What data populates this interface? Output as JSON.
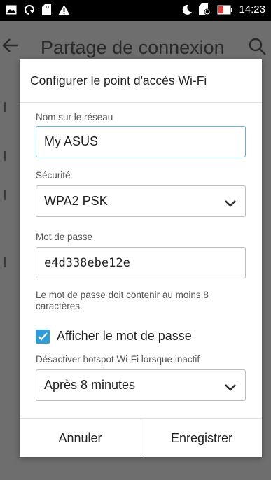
{
  "status_bar": {
    "time": "14:23",
    "icons_left": [
      "gallery-icon",
      "refresh-icon",
      "sd-card-icon",
      "warning-icon"
    ],
    "icons_right": [
      "moon-icon",
      "battery-saver-icon",
      "battery-icon"
    ],
    "battery_color": "#e53935"
  },
  "background_screen": {
    "title": "Partage de connexion"
  },
  "dialog": {
    "title": "Configurer le point d'accès Wi-Fi",
    "network_name": {
      "label": "Nom sur le réseau",
      "value": "My ASUS"
    },
    "security": {
      "label": "Sécurité",
      "selected": "WPA2 PSK"
    },
    "password": {
      "label": "Mot de passe",
      "value": "e4d338ebe12e",
      "hint": "Le mot de passe doit contenir au moins 8 caractères."
    },
    "show_password": {
      "label": "Afficher le mot de passe",
      "checked": true
    },
    "inactive_timeout": {
      "label": "Désactiver hotspot Wi-Fi lorsque inactif",
      "selected": "Après 8 minutes"
    },
    "actions": {
      "cancel_label": "Annuler",
      "save_label": "Enregistrer"
    },
    "accent_color": "#2e9cd8",
    "focus_color": "#5cb8d6"
  }
}
